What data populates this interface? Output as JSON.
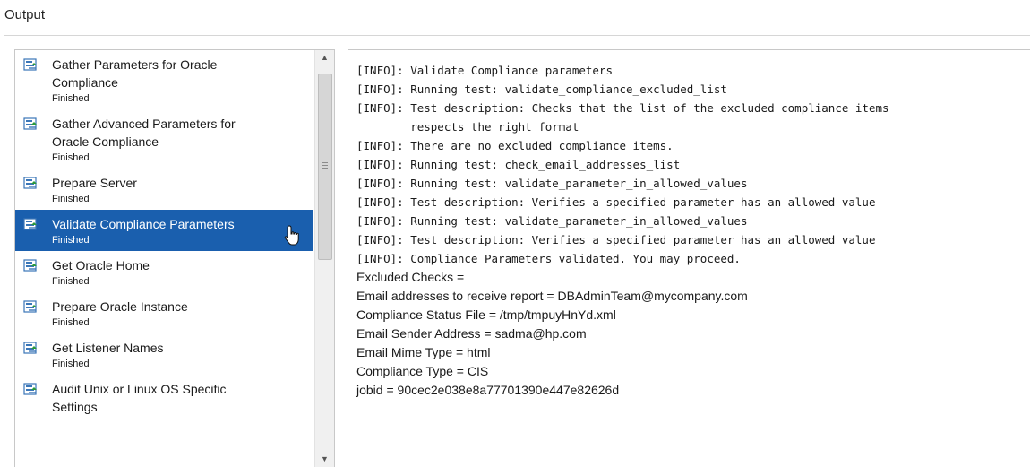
{
  "header": {
    "title": "Output"
  },
  "steps": [
    {
      "name": "Gather Parameters for Oracle Compliance",
      "name_lines": [
        "Gather Parameters for Oracle",
        "Compliance"
      ],
      "status": "Finished",
      "selected": false
    },
    {
      "name": "Gather Advanced Parameters for Oracle Compliance",
      "name_lines": [
        "Gather Advanced Parameters for",
        "Oracle Compliance"
      ],
      "status": "Finished",
      "selected": false
    },
    {
      "name": "Prepare Server",
      "name_lines": [
        "Prepare Server"
      ],
      "status": "Finished",
      "selected": false
    },
    {
      "name": "Validate Compliance Parameters",
      "name_lines": [
        "Validate Compliance Parameters"
      ],
      "status": "Finished",
      "selected": true
    },
    {
      "name": "Get Oracle Home",
      "name_lines": [
        "Get Oracle Home"
      ],
      "status": "Finished",
      "selected": false
    },
    {
      "name": "Prepare Oracle Instance",
      "name_lines": [
        "Prepare Oracle Instance"
      ],
      "status": "Finished",
      "selected": false
    },
    {
      "name": "Get Listener Names",
      "name_lines": [
        "Get Listener Names"
      ],
      "status": "Finished",
      "selected": false
    },
    {
      "name": "Audit Unix or Linux OS Specific Settings",
      "name_lines": [
        "Audit Unix or Linux OS Specific",
        "Settings"
      ],
      "status": "",
      "selected": false
    }
  ],
  "output": {
    "log_lines": [
      "[INFO]: Validate Compliance parameters",
      "[INFO]: Running test: validate_compliance_excluded_list",
      "[INFO]: Test description: Checks that the list of the excluded compliance items",
      "        respects the right format",
      "[INFO]: There are no excluded compliance items.",
      "[INFO]: Running test: check_email_addresses_list",
      "[INFO]: Running test: validate_parameter_in_allowed_values",
      "[INFO]: Test description: Verifies a specified parameter has an allowed value",
      "[INFO]: Running test: validate_parameter_in_allowed_values",
      "[INFO]: Test description: Verifies a specified parameter has an allowed value",
      "[INFO]: Compliance Parameters validated. You may proceed."
    ],
    "kv_lines": [
      "Excluded Checks =",
      "Email addresses to receive report = DBAdminTeam@mycompany.com",
      "Compliance Status File = /tmp/tmpuyHnYd.xml",
      "Email Sender Address = sadma@hp.com",
      "Email Mime Type = html",
      "Compliance Type = CIS",
      "jobid = 90cec2e038e8a77701390e447e82626d"
    ]
  },
  "icons": {
    "step_icon": "workflow-step-icon",
    "cursor": "hand-pointer-icon"
  },
  "colors": {
    "selected_bg": "#1a5fae",
    "selected_text": "#ffffff",
    "text": "#1a1a1a"
  }
}
